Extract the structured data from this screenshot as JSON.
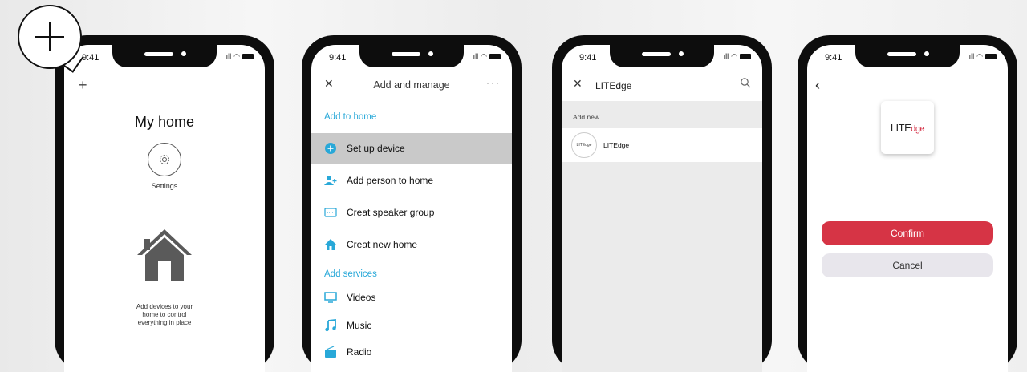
{
  "status": {
    "time": "9:41"
  },
  "screen1": {
    "plus": "+",
    "title": "My home",
    "settings_label": "Settings",
    "empty_text": "Add devices to your\nhome to control\neverything in place"
  },
  "screen2": {
    "close": "✕",
    "title": "Add and manage",
    "more": "···",
    "section_home": "Add to home",
    "items_home": [
      {
        "label": "Set up device",
        "icon": "plus-circle-icon"
      },
      {
        "label": "Add person to home",
        "icon": "add-person-icon"
      },
      {
        "label": "Creat speaker group",
        "icon": "speaker-group-icon"
      },
      {
        "label": "Creat new home",
        "icon": "home-icon"
      }
    ],
    "section_services": "Add services",
    "items_services": [
      {
        "label": "Videos",
        "icon": "monitor-icon"
      },
      {
        "label": "Music",
        "icon": "music-note-icon"
      },
      {
        "label": "Radio",
        "icon": "radio-icon"
      }
    ]
  },
  "screen3": {
    "close": "✕",
    "query": "LITEdge",
    "section": "Add new",
    "result_logo": "LITEdge",
    "result_name": "LITEdge"
  },
  "screen4": {
    "back": "‹",
    "logo_main": "LITE",
    "logo_accent": "dge",
    "confirm": "Confirm",
    "cancel": "Cancel"
  },
  "colors": {
    "accent_blue": "#28a8d8",
    "confirm_red": "#d63445",
    "selected_row": "#c9c9c9"
  }
}
